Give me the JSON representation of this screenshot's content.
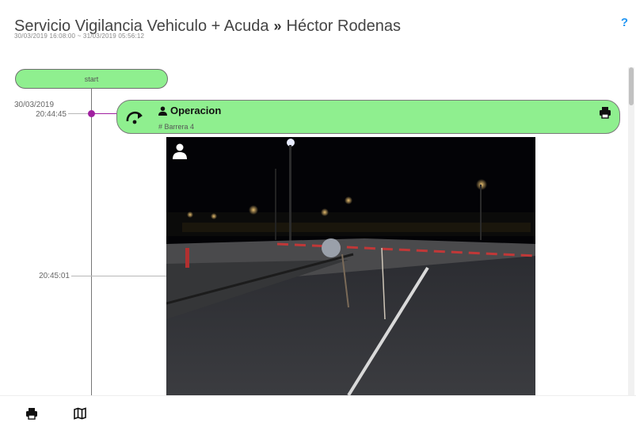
{
  "header": {
    "title": "Servicio Vigilancia Vehiculo + Acuda",
    "separator": "»",
    "person": "Héctor Rodenas",
    "date_range": "30/03/2019 16:08:00 ~ 31/03/2019 05:56:12",
    "help_label": "?"
  },
  "timeline": {
    "start_label": "start",
    "ticks": [
      {
        "date": "30/03/2019",
        "time": "20:44:45"
      },
      {
        "time": "20:45:01"
      }
    ]
  },
  "event": {
    "title": "Operacion",
    "subtitle": "# Barrera 4",
    "icon": "rotate-cw-icon",
    "title_icon": "user-icon",
    "action_icon": "print-icon"
  },
  "footer": {
    "icons": [
      "print-icon",
      "map-icon"
    ]
  },
  "colors": {
    "event_fill": "#8fef8f",
    "timeline_dot": "#a020a0",
    "help": "#2196f3"
  }
}
